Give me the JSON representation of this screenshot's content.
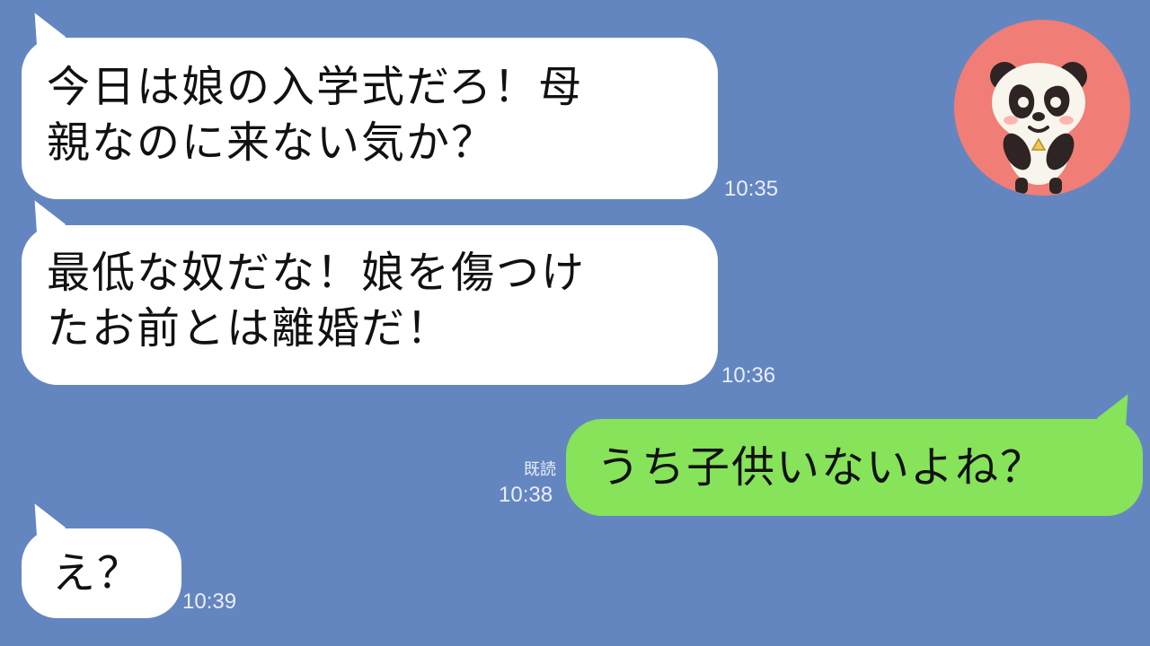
{
  "conversation": {
    "messages": [
      {
        "side": "left",
        "lines": [
          "今日は娘の入学式だろ！母",
          "親なのに来ない気か？"
        ],
        "time": "10:35"
      },
      {
        "side": "left",
        "lines": [
          "最低な奴だな！娘を傷つけ",
          "たお前とは離婚だ！"
        ],
        "time": "10:36"
      },
      {
        "side": "right",
        "lines": [
          "うち子供いないよね？"
        ],
        "read_label": "既読",
        "time": "10:38"
      },
      {
        "side": "left",
        "lines": [
          "え？"
        ],
        "time": "10:39"
      }
    ]
  },
  "avatar": {
    "icon": "panda-icon",
    "background": "#f07d76"
  },
  "theme": {
    "background": "#6486c0",
    "incoming_bubble": "#ffffff",
    "outgoing_bubble": "#86e35a"
  }
}
